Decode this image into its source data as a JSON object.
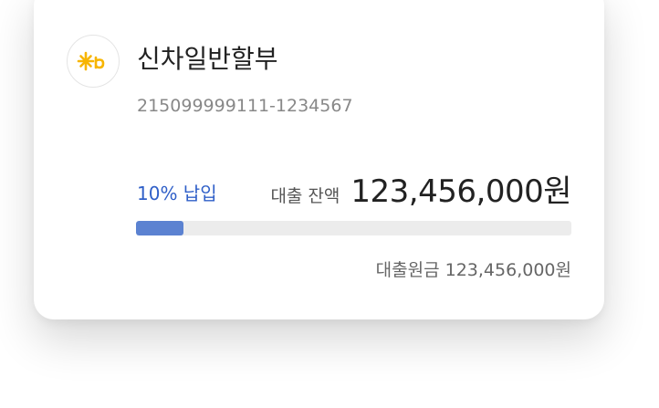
{
  "loan": {
    "product_name": "신차일반할부",
    "account_number": "215099999111-1234567",
    "paid_rate_text": "10% 납입",
    "paid_fraction": 0.11,
    "balance_label": "대출 잔액",
    "balance_value": "123,456,000원",
    "principal_text": "대출원금 123,456,000원"
  },
  "icons": {
    "bank_logo": "kb-star-logo-icon"
  },
  "colors": {
    "accent": "#2f5fc8",
    "progress_fill": "#5b82d1",
    "progress_track": "#ececec",
    "logo_yellow": "#f7b500"
  }
}
